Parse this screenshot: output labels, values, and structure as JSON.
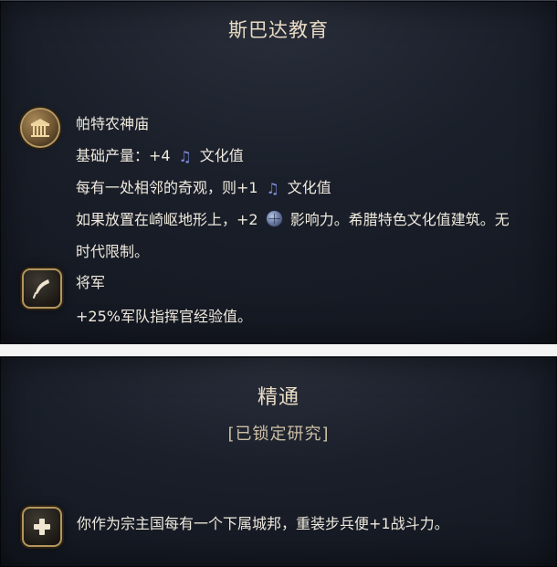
{
  "top_card": {
    "title": "斯巴达教育",
    "wonder_name": "帕特农神庙",
    "line_base_output_prefix": "基础产量：+4",
    "line_base_output_suffix": "文化值",
    "line_adjacent_prefix": "每有一处相邻的奇观，则+1",
    "line_adjacent_suffix": "文化值",
    "line_rough_prefix": "如果放置在崎岖地形上，+2",
    "line_rough_suffix": "影响力。希腊特色文化值建筑。无",
    "line_rough_cont": "时代限制。",
    "general_title": "将军",
    "general_effect": "+25%军队指挥官经验值。",
    "icons": {
      "wonder": "temple-icon",
      "culture": "music-note-icon",
      "influence": "globe-icon",
      "general": "quill-icon"
    }
  },
  "bottom_card": {
    "title": "精通",
    "subtitle": "[已锁定研究]",
    "effect_text": "你作为宗主国每有一个下属城邦，重装步兵便+1战斗力。",
    "icons": {
      "effect": "plus-icon"
    }
  },
  "colors": {
    "panel_bg": "#1a1f2a",
    "gold_accent": "#b3965d",
    "culture_icon": "#7d8ddb",
    "divider": "#f4f4f4"
  }
}
